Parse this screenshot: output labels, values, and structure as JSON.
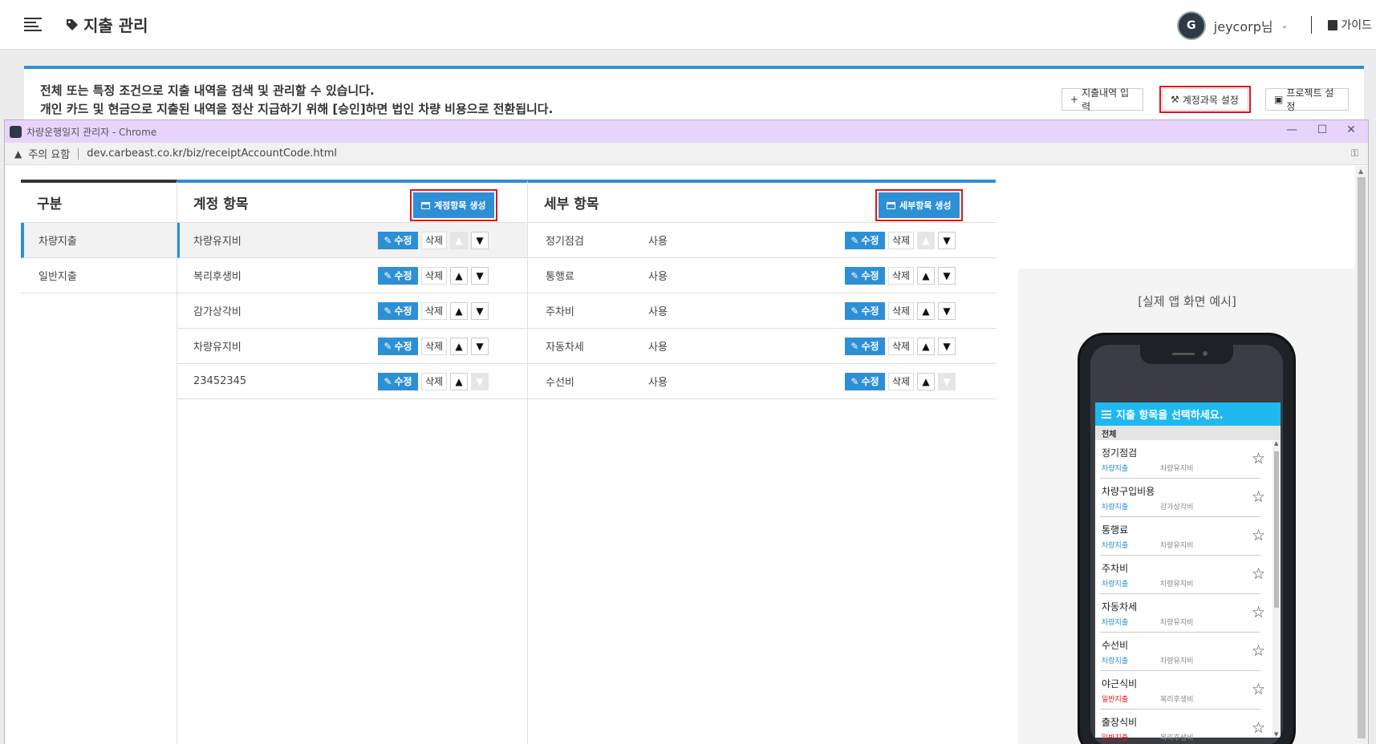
{
  "topbar": {
    "title": "지출 관리",
    "user_name": "jeycorp님",
    "avatar_text": "G",
    "guide_label": "가이드"
  },
  "card": {
    "desc_line1": "전체 또는 특정 조건으로 지출 내역을 검색 및 관리할 수 있습니다.",
    "desc_line2": "개인 카드 및 현금으로 지출된 내역을 정산 지급하기 위해 [승인]하면 법인 차량 비용으로 전환됩니다.",
    "btn_add": "지출내역 입력",
    "btn_account": "계정과목 설정",
    "btn_project": "프로젝트 설정"
  },
  "popup": {
    "title": "차량운행일지 관리자 - Chrome",
    "security": "주의 요함",
    "url": "dev.carbeast.co.kr/biz/receiptAccountCode.html"
  },
  "columns": {
    "gubun_header": "구분",
    "account_header": "계정 항목",
    "account_create": "계정항목 생성",
    "detail_header": "세부 항목",
    "detail_create": "세부항목 생성",
    "edit_label": "수정",
    "delete_label": "삭제"
  },
  "gubun": [
    "차량지출",
    "일반지출"
  ],
  "accounts": [
    "차량유지비",
    "복리후생비",
    "감가상각비",
    "차량유지비",
    "23452345"
  ],
  "details": [
    {
      "name": "정기점검",
      "use": "사용"
    },
    {
      "name": "통행료",
      "use": "사용"
    },
    {
      "name": "주차비",
      "use": "사용"
    },
    {
      "name": "자동차세",
      "use": "사용"
    },
    {
      "name": "수선비",
      "use": "사용"
    }
  ],
  "preview": {
    "title": "[실제 앱 화면 예시]",
    "app_header": "지출 항목을 선택하세요.",
    "all_label": "전체",
    "items": [
      {
        "name": "정기점검",
        "cat": "차량지출",
        "sub": "차량유지비"
      },
      {
        "name": "차량구입비용",
        "cat": "차량지출",
        "sub": "감가상각비"
      },
      {
        "name": "통행료",
        "cat": "차량지출",
        "sub": "차량유지비"
      },
      {
        "name": "주차비",
        "cat": "차량지출",
        "sub": "차량유지비"
      },
      {
        "name": "자동차세",
        "cat": "차량지출",
        "sub": "차량유지비"
      },
      {
        "name": "수선비",
        "cat": "차량지출",
        "sub": "차량유지비"
      },
      {
        "name": "야근식비",
        "cat": "일반지출",
        "sub": "복리후생비"
      },
      {
        "name": "출장식비",
        "cat": "일반지출",
        "sub": "복리후생비"
      }
    ]
  },
  "colors": {
    "accent": "#2d8fd5",
    "highlight_red": "#e0151b",
    "popup_titlebar": "#e8d4fb",
    "app_header": "#1fb8ef"
  }
}
